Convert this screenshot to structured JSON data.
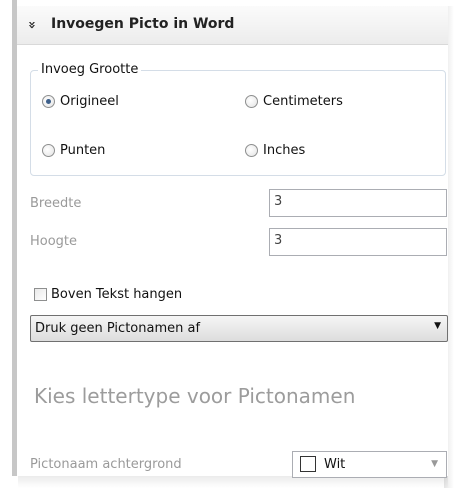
{
  "header": {
    "collapse_icon": "chevrons-down-icon",
    "collapse_glyph": "»",
    "title": "Invoegen Picto in Word"
  },
  "size_group": {
    "legend": "Invoeg Grootte",
    "options": [
      {
        "label": "Origineel",
        "checked": true
      },
      {
        "label": "Centimeters",
        "checked": false
      },
      {
        "label": "Punten",
        "checked": false
      },
      {
        "label": "Inches",
        "checked": false
      }
    ]
  },
  "width_field": {
    "label": "Breedte",
    "value": "3"
  },
  "height_field": {
    "label": "Hoogte",
    "value": "3"
  },
  "hang_above_text": {
    "label": "Boven Tekst hangen",
    "checked": false
  },
  "name_print_select": {
    "value": "Druk geen Pictonamen af",
    "arrow_icon": "triangle-down-icon"
  },
  "font_link": "Kies lettertype voor Pictonamen",
  "name_background": {
    "label": "Pictonaam achtergrond",
    "value": "Wit",
    "swatch_color": "#ffffff"
  },
  "colors": {
    "header_bg": "#efefef",
    "radio_fill": "#3d5f8a",
    "muted_text": "#9a9a9a",
    "panel_border": "#c7c7c7"
  }
}
